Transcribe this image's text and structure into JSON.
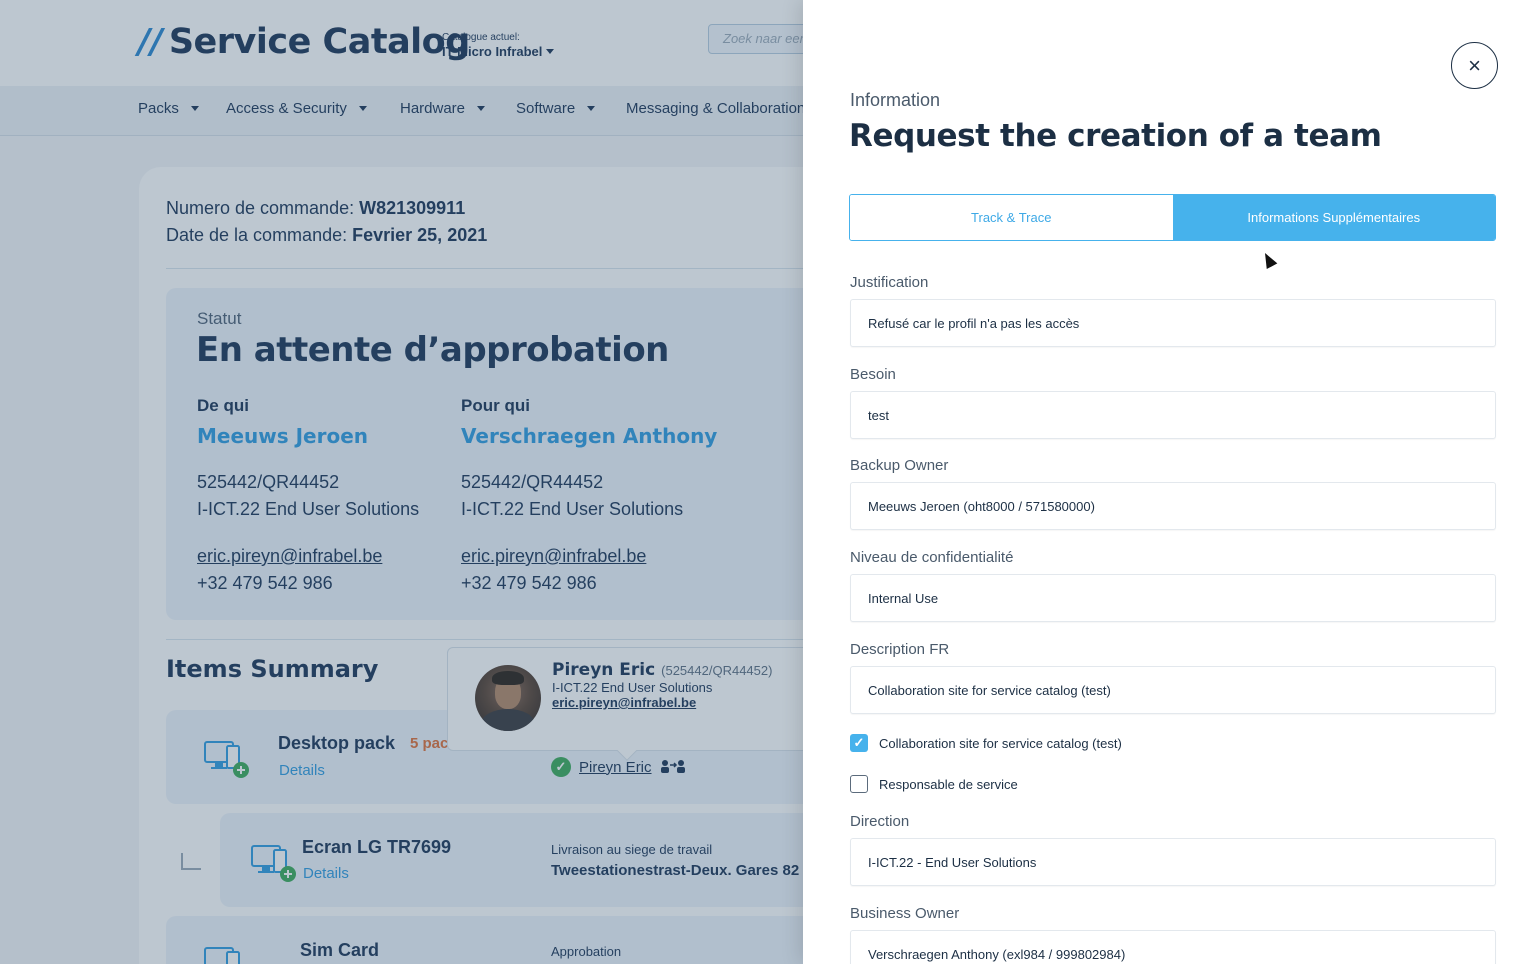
{
  "header": {
    "logo_slashes": "//",
    "logo_text": "Service Catalog",
    "catalog_small": "Catalogue actuel:",
    "catalog_current": "IT Micro Infrabel",
    "search_placeholder": "Zoek naar een"
  },
  "nav": {
    "items": [
      {
        "label": "Packs"
      },
      {
        "label": "Access & Security"
      },
      {
        "label": "Hardware"
      },
      {
        "label": "Software"
      },
      {
        "label": "Messaging & Collaboration"
      }
    ]
  },
  "order": {
    "number_label": "Numero de commande:",
    "number_value": "W821309911",
    "date_label": "Date de la commande:",
    "date_value": "Fevrier 25, 2021"
  },
  "status": {
    "label": "Statut",
    "value": "En attente d’approbation",
    "from": {
      "heading": "De qui",
      "name": "Meeuws Jeroen",
      "id": "525442/QR44452",
      "dept": "I-ICT.22 End User Solutions",
      "email": "eric.pireyn@infrabel.be",
      "phone": "+32 479 542 986"
    },
    "for": {
      "heading": "Pour qui",
      "name": "Verschraegen Anthony",
      "id": "525442/QR44452",
      "dept": "I-ICT.22 End User Solutions",
      "email": "eric.pireyn@infrabel.be",
      "phone": "+32 479 542 986"
    }
  },
  "items": {
    "title": "Items Summary",
    "rows": [
      {
        "name": "Desktop pack",
        "qty": "5 pac",
        "details": "Details",
        "approver": "Pireyn Eric"
      },
      {
        "name": "Ecran LG TR7699",
        "details": "Details",
        "delivery_label": "Livraison au siege de travail",
        "delivery_value": "Tweestationestrast-Deux. Gares 82"
      },
      {
        "name": "Sim Card",
        "delivery_label": "Approbation"
      }
    ]
  },
  "tooltip": {
    "name": "Pireyn Eric",
    "id": "(525442/QR44452)",
    "dept": "I-ICT.22 End User Solutions",
    "email": "eric.pireyn@infrabel.be"
  },
  "panel": {
    "close_icon": "×",
    "kicker": "Information",
    "title": "Request the creation of a team",
    "tabs": [
      {
        "label": "Track & Trace",
        "active": false
      },
      {
        "label": "Informations Supplémentaires",
        "active": true
      }
    ],
    "fields": [
      {
        "label": "Justification",
        "value": "Refusé car le profil n'a pas les accès"
      },
      {
        "label": "Besoin",
        "value": "test"
      },
      {
        "label": "Backup Owner",
        "value": "Meeuws Jeroen (oht8000 / 571580000)"
      },
      {
        "label": "Niveau de confidentialité",
        "value": "Internal Use"
      },
      {
        "label": "Description FR",
        "value": "Collaboration site for service catalog (test)"
      },
      {
        "label": "Direction",
        "value": "I-ICT.22 - End User Solutions"
      },
      {
        "label": "Business Owner",
        "value": "Verschraegen Anthony (exl984 / 999802984)"
      }
    ],
    "checkboxes": [
      {
        "label": "Collaboration site for service catalog (test)",
        "checked": true
      },
      {
        "label": "Responsable de service",
        "checked": false
      }
    ]
  },
  "colors": {
    "accent": "#46b2ec",
    "navy": "#1c3557",
    "warning": "#e0703a",
    "success": "#3cab5a"
  }
}
